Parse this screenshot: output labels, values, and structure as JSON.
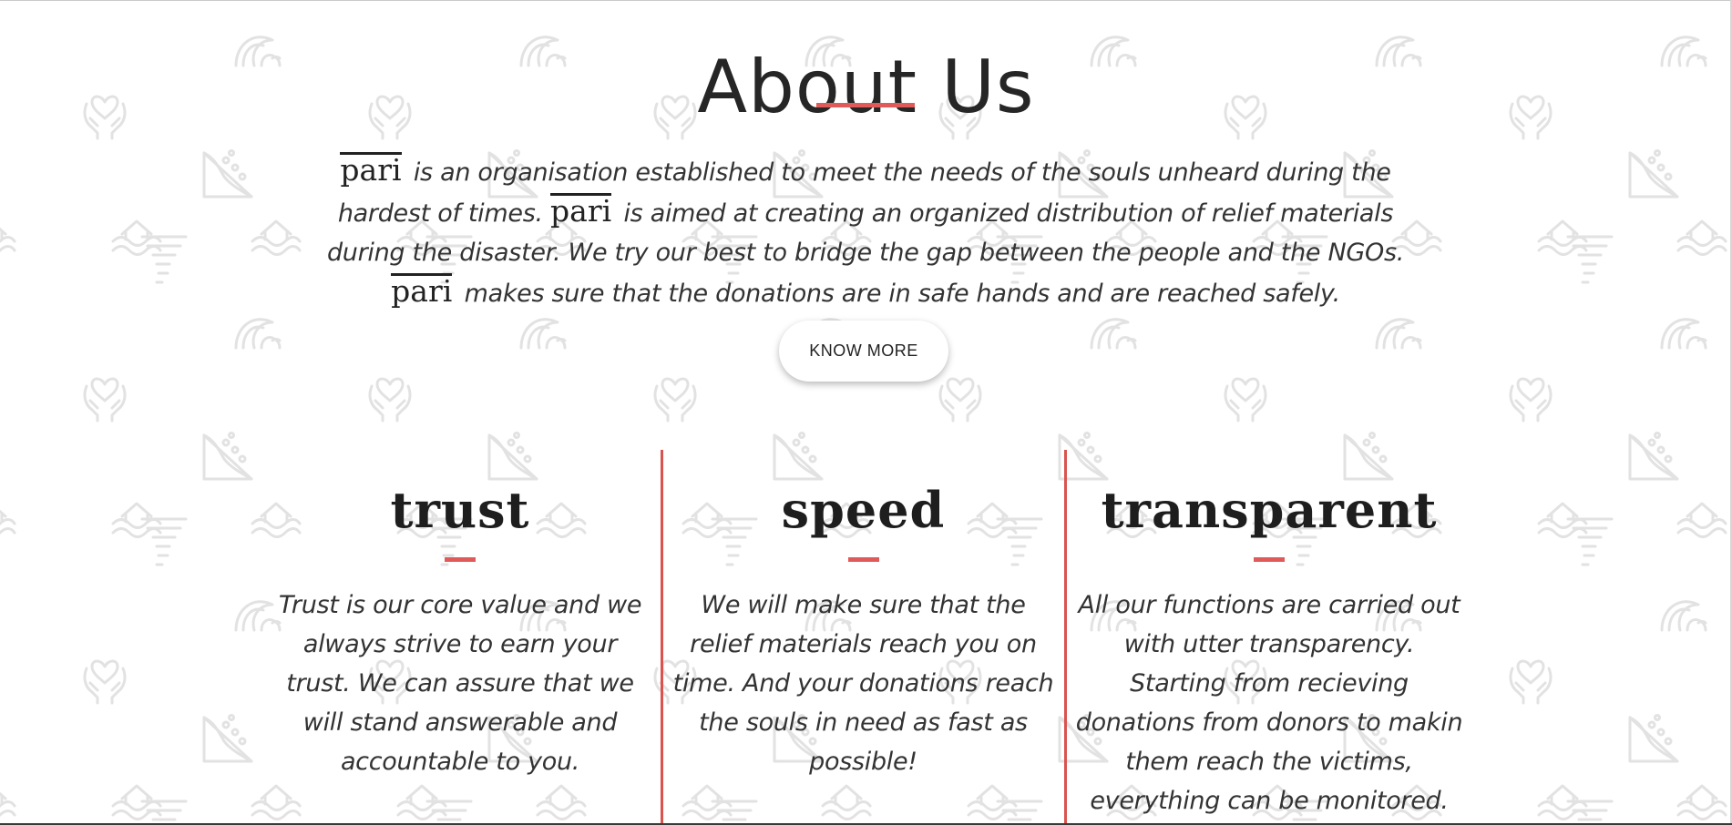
{
  "about": {
    "title": "About Us",
    "brand": "pari",
    "intro_part1": "is an organisation established to meet the needs of the souls unheard during the hardest of times.",
    "intro_part2": "is aimed at creating an organized distribution of relief materials during the disaster. We try our best to bridge the gap between the people and the NGOs.",
    "intro_part3": "makes sure that the donations are in safe hands and are reached safely.",
    "know_more_label": "KNOW MORE"
  },
  "values": [
    {
      "heading": "trust",
      "text": "Trust is our core value and we always strive to earn your trust. We can assure that we will stand answerable and accountable to you."
    },
    {
      "heading": "speed",
      "text": "We will make sure that the relief materials reach you on time. And your donations reach the souls in need as fast as possible!"
    },
    {
      "heading": "transparent",
      "text": "All our functions are carried out with utter transparency. Starting from recieving donations from donors to makin them reach the victims, everything can be monitored."
    }
  ],
  "colors": {
    "accent": "#e05a5a",
    "text": "#333333",
    "background": "#ffffff",
    "pattern_icon": "#e3e3e3"
  },
  "pattern_icons": [
    "wave-icon",
    "heart-hands-icon",
    "landslide-icon",
    "flood-house-icon",
    "tornado-icon"
  ]
}
